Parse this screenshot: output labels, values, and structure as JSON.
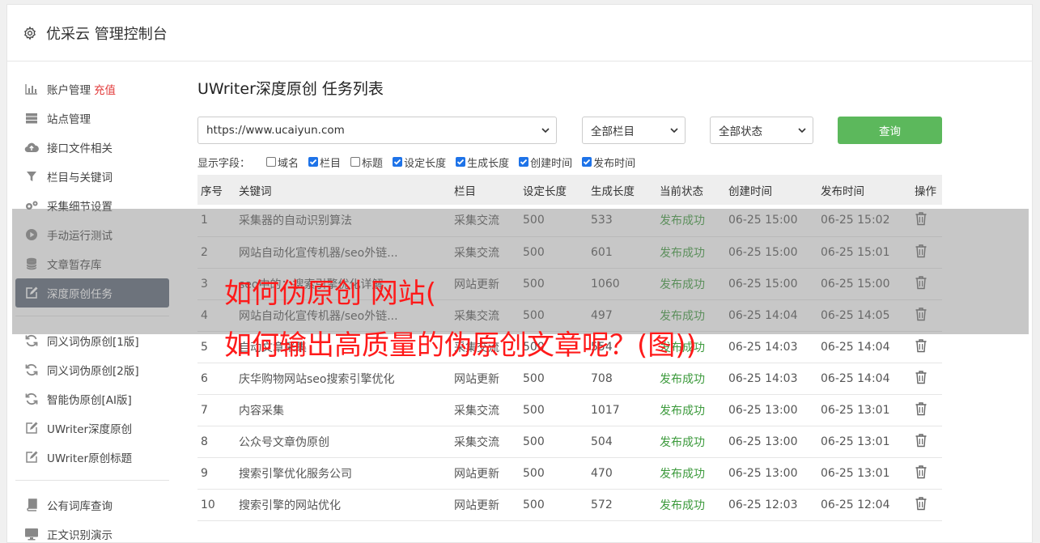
{
  "app": {
    "title": "优采云 管理控制台"
  },
  "sidebar": {
    "recharge_label": "充值",
    "group1": [
      {
        "label": "账户管理",
        "icon": "bar-chart-icon"
      },
      {
        "label": "站点管理",
        "icon": "server-icon"
      },
      {
        "label": "接口文件相关",
        "icon": "cloud-upload-icon"
      },
      {
        "label": "栏目与关键词",
        "icon": "filter-icon"
      },
      {
        "label": "采集细节设置",
        "icon": "cogs-icon"
      },
      {
        "label": "手动运行测试",
        "icon": "play-icon"
      },
      {
        "label": "文章暂存库",
        "icon": "database-icon"
      },
      {
        "label": "深度原创任务",
        "icon": "edit-icon"
      }
    ],
    "group2": [
      {
        "label": "同义词伪原创[1版]",
        "icon": "refresh-icon"
      },
      {
        "label": "同义词伪原创[2版]",
        "icon": "refresh-icon"
      },
      {
        "label": "智能伪原创[AI版]",
        "icon": "refresh-icon"
      },
      {
        "label": "UWriter深度原创",
        "icon": "edit-icon"
      },
      {
        "label": "UWriter原创标题",
        "icon": "edit-icon"
      }
    ],
    "group3": [
      {
        "label": "公有词库查询",
        "icon": "book-icon"
      },
      {
        "label": "正文识别演示",
        "icon": "monitor-icon"
      }
    ]
  },
  "main": {
    "title": "UWriter深度原创 任务列表",
    "site_select": "https://www.ucaiyun.com",
    "column_select": "全部栏目",
    "status_select": "全部状态",
    "query_label": "查询",
    "fields_label": "显示字段：",
    "fields": [
      {
        "label": "域名",
        "checked": false
      },
      {
        "label": "栏目",
        "checked": true
      },
      {
        "label": "标题",
        "checked": false
      },
      {
        "label": "设定长度",
        "checked": true
      },
      {
        "label": "生成长度",
        "checked": true
      },
      {
        "label": "创建时间",
        "checked": true
      },
      {
        "label": "发布时间",
        "checked": true
      }
    ],
    "columns": [
      "序号",
      "关键词",
      "栏目",
      "设定长度",
      "生成长度",
      "当前状态",
      "创建时间",
      "发布时间",
      "操作"
    ],
    "rows": [
      [
        "1",
        "采集器的自动识别算法",
        "采集交流",
        "500",
        "533",
        "发布成功",
        "06-25 15:00",
        "06-25 15:02"
      ],
      [
        "2",
        "网站自动化宣传机器/seo外链...",
        "采集交流",
        "500",
        "601",
        "发布成功",
        "06-25 15:00",
        "06-25 15:01"
      ],
      [
        "3",
        "seo中的：搜索引擎优化详解",
        "网站更新",
        "500",
        "1060",
        "发布成功",
        "06-25 15:00",
        "06-25 15:00"
      ],
      [
        "4",
        "网站自动化宣传机器/seo外链...",
        "采集交流",
        "500",
        "497",
        "发布成功",
        "06-25 14:04",
        "06-25 14:05"
      ],
      [
        "5",
        "自动文章采集",
        "采集交流",
        "500",
        "554",
        "发布成功",
        "06-25 14:03",
        "06-25 14:04"
      ],
      [
        "6",
        "庆华购物网站seo搜索引擎优化",
        "网站更新",
        "500",
        "708",
        "发布成功",
        "06-25 14:03",
        "06-25 14:04"
      ],
      [
        "7",
        "内容采集",
        "采集交流",
        "500",
        "1017",
        "发布成功",
        "06-25 13:00",
        "06-25 13:01"
      ],
      [
        "8",
        "公众号文章伪原创",
        "采集交流",
        "500",
        "504",
        "发布成功",
        "06-25 13:00",
        "06-25 13:01"
      ],
      [
        "9",
        "搜索引擎优化服务公司",
        "网站更新",
        "500",
        "470",
        "发布成功",
        "06-25 13:00",
        "06-25 13:01"
      ],
      [
        "10",
        "搜索引擎的网站优化",
        "网站更新",
        "500",
        "572",
        "发布成功",
        "06-25 12:03",
        "06-25 12:04"
      ]
    ]
  },
  "overlay": {
    "line1": "如何伪原创 网站(",
    "line2": "如何输出高质量的伪原创文章呢？(图))"
  },
  "colors": {
    "accent": "#5cb85c",
    "active_nav": "#5b6777",
    "success": "#3c9a3c",
    "headline": "#ff1a1a",
    "checkbox": "#1e73e8"
  }
}
